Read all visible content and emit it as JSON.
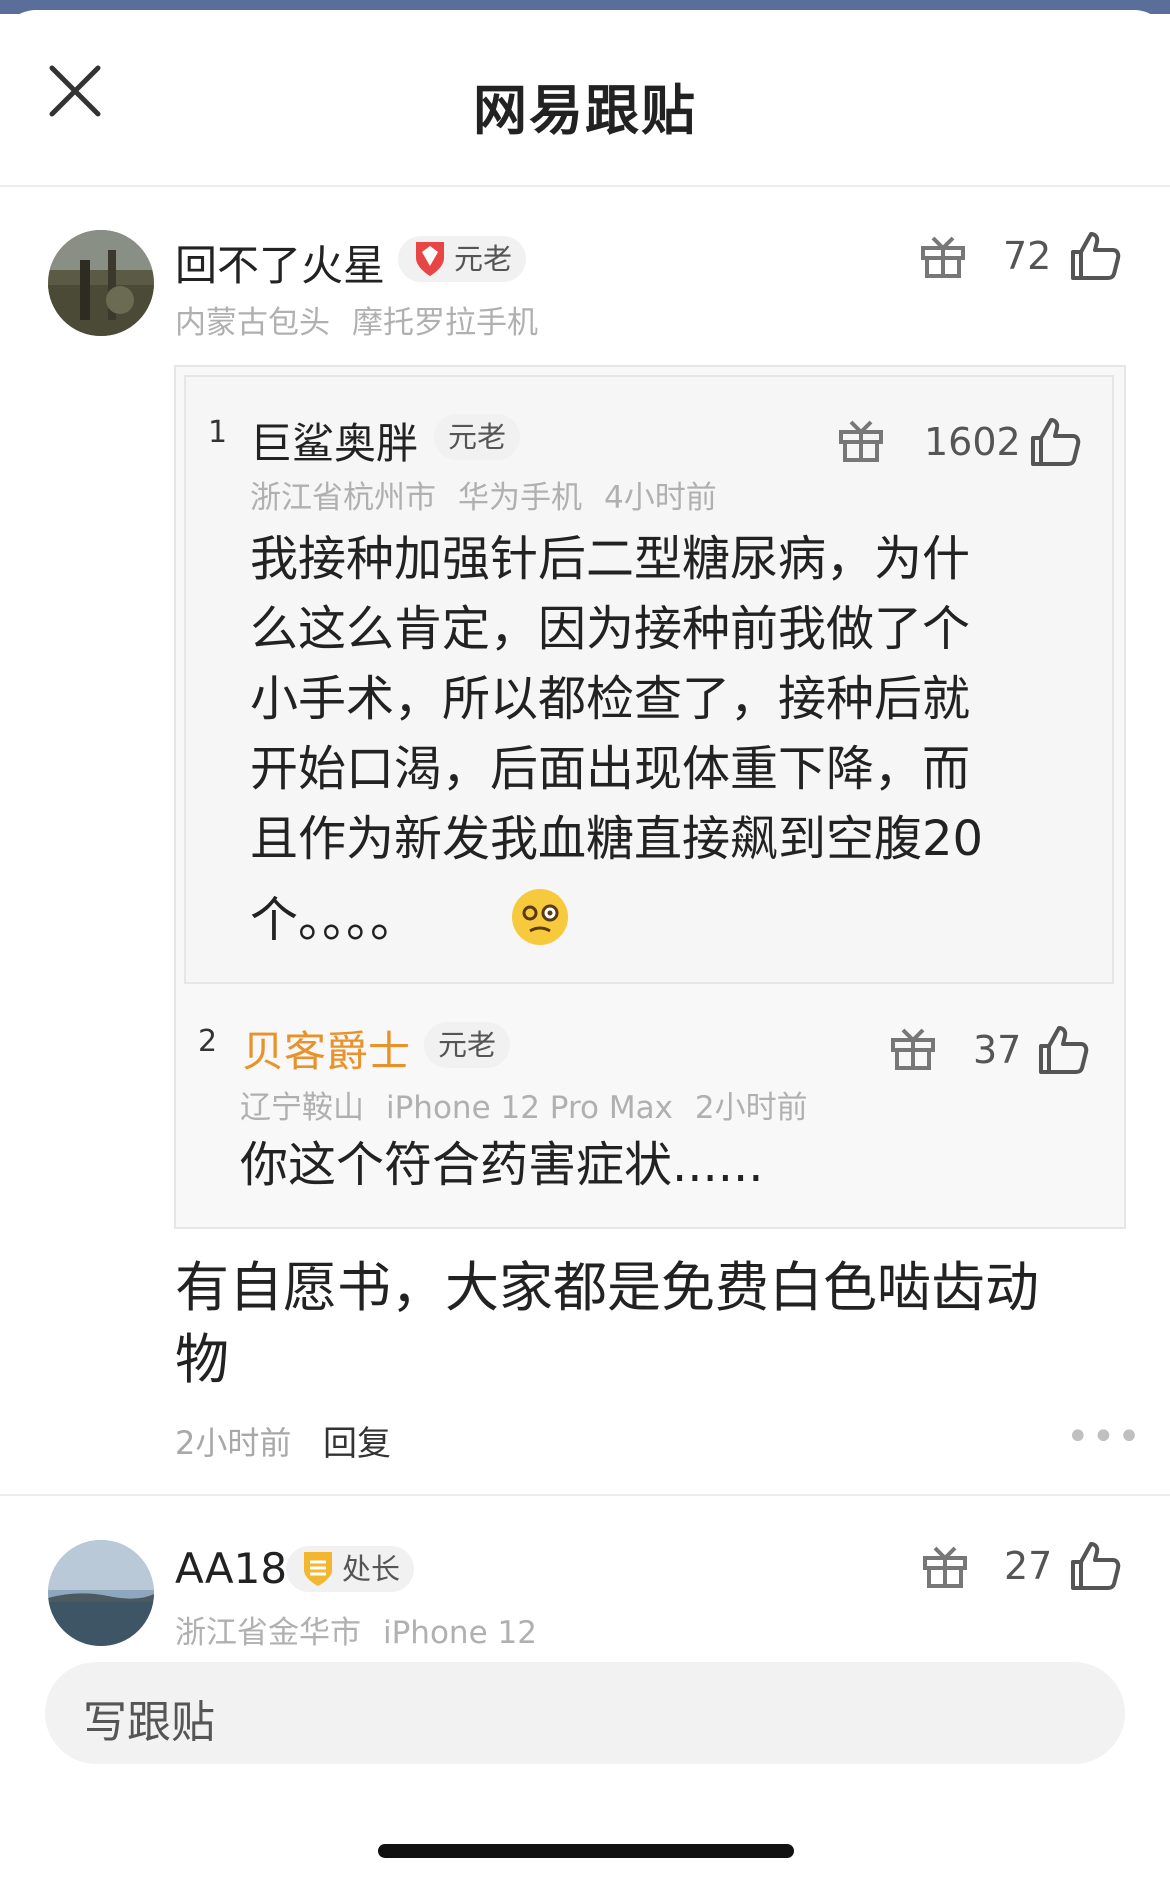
{
  "header": {
    "title": "网易跟贴",
    "close_icon": "close-icon"
  },
  "comment1": {
    "username": "回不了火星",
    "badge": "元老",
    "badge_icon": "shield-badge-icon",
    "location": "内蒙古包头",
    "device": "摩托罗拉手机",
    "likes": "72",
    "text_line1": "有自愿书，大家都是免费白色啮齿动",
    "text_line2": "物",
    "time": "2小时前",
    "reply_label": "回复",
    "more": "•••"
  },
  "quote1": {
    "floor": "1",
    "username": "巨鲨奥胖",
    "badge": "元老",
    "location": "浙江省杭州市",
    "device": "华为手机",
    "time": "4小时前",
    "likes": "1602",
    "lines": [
      "我接种加强针后二型糖尿病，为什",
      "么这么肯定，因为接种前我做了个",
      "小手术，所以都检查了，接种后就",
      "开始口渴，后面出现体重下降，而",
      "且作为新发我血糖直接飙到空腹20",
      "个。。。。"
    ],
    "emoji": "dizzy-face-emoji"
  },
  "quote2": {
    "floor": "2",
    "username": "贝客爵士",
    "badge": "元老",
    "location": "辽宁鞍山",
    "device": "iPhone 12 Pro Max",
    "time": "2小时前",
    "likes": "37",
    "text": "你这个符合药害症状......"
  },
  "comment2": {
    "username": "AA18",
    "badge": "处长",
    "badge_icon": "rank-badge-icon",
    "location": "浙江省金华市",
    "device": "iPhone 12",
    "likes": "27"
  },
  "compose": {
    "placeholder": "写跟贴"
  },
  "colors": {
    "accent_orange": "#e8922a",
    "badge_red": "#e84545",
    "badge_gold": "#f2b630"
  }
}
